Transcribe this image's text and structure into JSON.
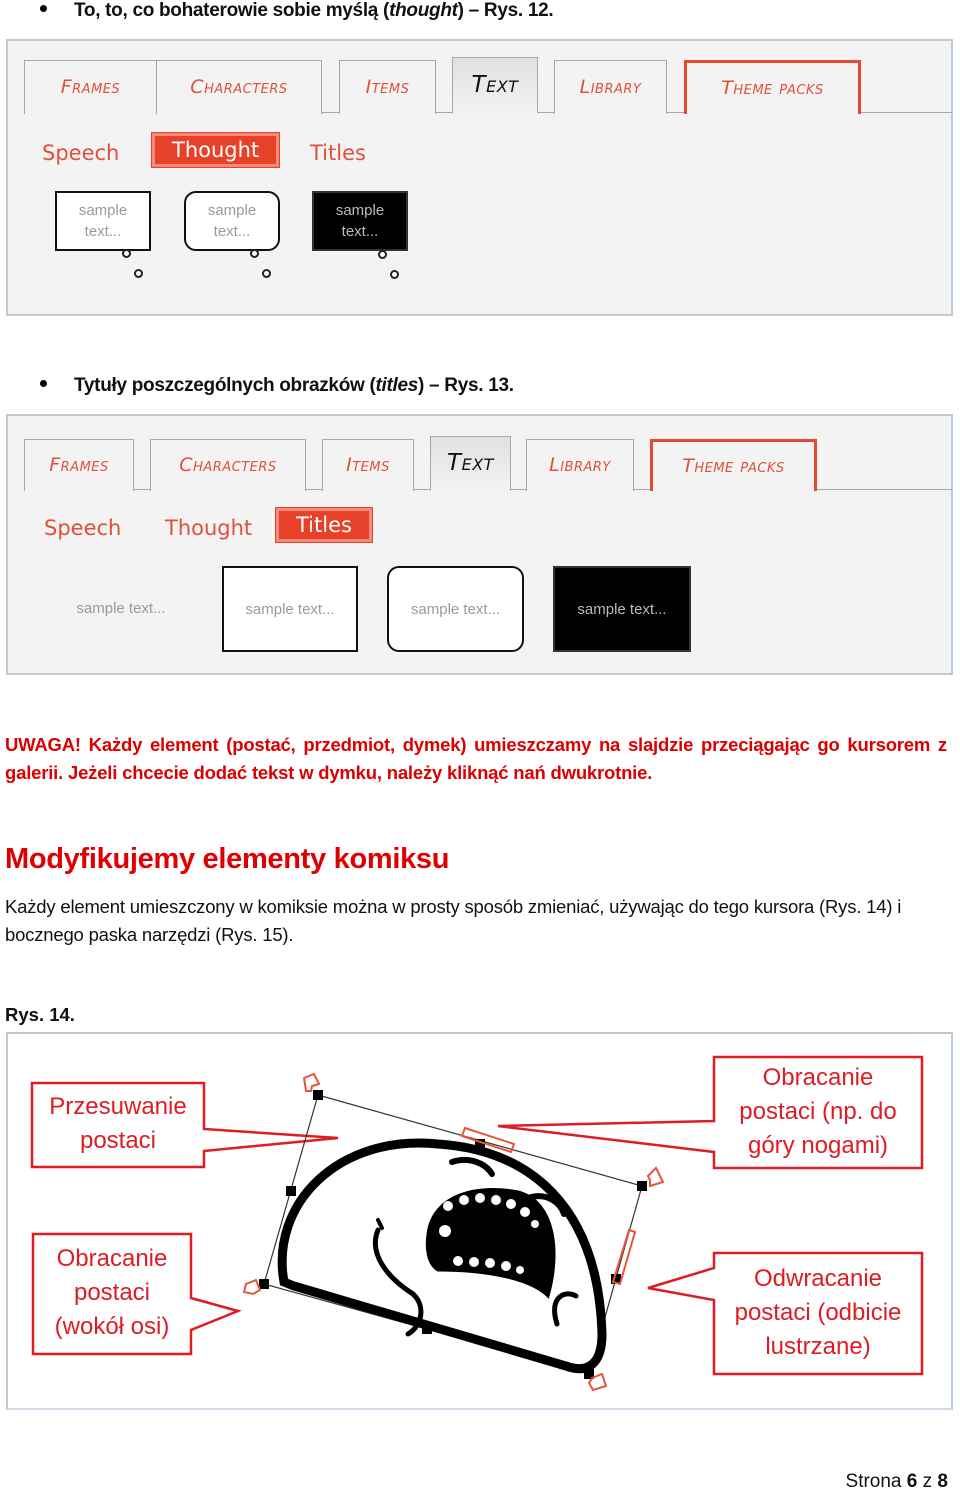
{
  "bullets": [
    {
      "before": "To, to, co bohaterowie sobie myślą (",
      "italic": "thought",
      "after": ") – Rys. 12."
    },
    {
      "before": "Tytuły poszczególnych obrazków (",
      "italic": "titles",
      "after": ") – Rys. 13."
    }
  ],
  "figure12": {
    "tabs": [
      "Frames",
      "Characters",
      "Items",
      "Text",
      "Library",
      "Theme packs"
    ],
    "active_tab": "Text",
    "subtabs": [
      "Speech",
      "Thought",
      "Titles"
    ],
    "active_subtab": "Thought",
    "bubbles": [
      {
        "text": "sample text...",
        "style": "square"
      },
      {
        "text": "sample text...",
        "style": "rounded"
      },
      {
        "text": "sample text...",
        "style": "dark"
      }
    ]
  },
  "figure13": {
    "tabs": [
      "Frames",
      "Characters",
      "Items",
      "Text",
      "Library",
      "Theme packs"
    ],
    "active_tab": "Text",
    "subtabs": [
      "Speech",
      "Thought",
      "Titles"
    ],
    "active_subtab": "Titles",
    "titles": [
      {
        "text": "sample text...",
        "style": "plain"
      },
      {
        "text": "sample text...",
        "style": "square"
      },
      {
        "text": "sample text...",
        "style": "rounded"
      },
      {
        "text": "sample text...",
        "style": "dark"
      }
    ]
  },
  "warning": {
    "label": "UWAGA!",
    "text": " Każdy element (postać, przedmiot, dymek) umieszczamy na slajdzie przeciągając go kursorem z galerii. Jeżeli chcecie dodać tekst w dymku, należy kliknąć nań dwukrotnie."
  },
  "section": {
    "heading": "Modyfikujemy elementy komiksu",
    "paragraph": "Każdy element umieszczony w komiksie można w prosty sposób zmieniać, używając do tego kursora (Rys. 14) i bocznego paska narzędzi (Rys. 15)."
  },
  "figure14": {
    "caption": "Rys. 14.",
    "callouts": {
      "move": [
        "Przesuwanie",
        "postaci"
      ],
      "rotate_flip": [
        "Obracanie",
        "postaci (np. do",
        "góry nogami)"
      ],
      "rotate_axis": [
        "Obracanie",
        "postaci",
        "(wokół osi)"
      ],
      "mirror": [
        "Odwracanie",
        "postaci (odbicie",
        "lustrzane)"
      ]
    },
    "accent_color": "#dd1c24"
  },
  "footer": {
    "prefix": "Strona ",
    "page": "6",
    "middle": " z ",
    "total": "8"
  }
}
